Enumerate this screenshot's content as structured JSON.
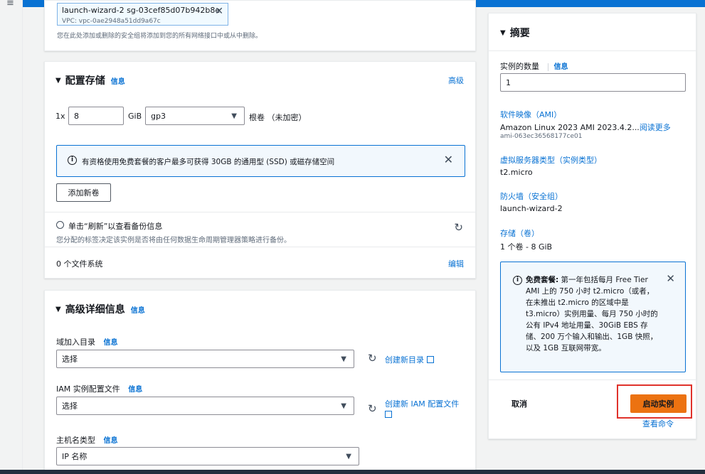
{
  "menu_icon": "menu-icon",
  "network": {
    "sg_chip_name": "launch-wizard-2   sg-03cef85d07b942b8e",
    "sg_chip_vpc": "VPC: vpc-0ae2948a51dd9a67c",
    "help_text": "您在此处添加或删除的安全组将添加到您的所有网络接口中或从中删除。"
  },
  "storage": {
    "title": "配置存储",
    "info": "信息",
    "advanced": "高级",
    "prefix": "1x",
    "size_value": "8",
    "size_unit": "GiB",
    "volume_type": "gp3",
    "root_label": "根卷  （未加密）",
    "alert_text": "有资格使用免费套餐的客户最多可获得 30GB 的通用型 (SSD) 或磁存储空间",
    "add_volume": "添加新卷",
    "backup_text": "单击“刷新”以查看备份信息",
    "backup_subtext": "您分配的标签决定该实例是否将由任何数据生命周期管理器策略进行备份。",
    "filesystems": "0 个文件系统",
    "edit": "编辑"
  },
  "advanced": {
    "title": "高级详细信息",
    "info": "信息",
    "domain_label": "域加入目录",
    "domain_info": "信息",
    "domain_value": "选择",
    "create_directory": "创建新目录",
    "iam_label": "IAM 实例配置文件",
    "iam_info": "信息",
    "iam_value": "选择",
    "create_iam": "创建新 IAM 配置文件",
    "hostname_label": "主机名类型",
    "hostname_info": "信息",
    "hostname_value": "IP 名称"
  },
  "summary": {
    "title": "摘要",
    "count_label": "实例的数量",
    "count_info": "信息",
    "count_value": "1",
    "ami_label": "软件映像（AMI）",
    "ami_value": "Amazon Linux 2023 AMI 2023.4.2...",
    "ami_more": "阅读更多",
    "ami_id": "ami-063ec36568177ce01",
    "type_label": "虚拟服务器类型（实例类型）",
    "type_value": "t2.micro",
    "firewall_label": "防火墙（安全组）",
    "firewall_value": "launch-wizard-2",
    "storage_label": "存储（卷）",
    "storage_value": "1 个卷 - 8 GiB",
    "free_tier_bold": "免费套餐:",
    "free_tier_text": " 第一年包括每月 Free Tier AMI 上的 750 小时 t2.micro（或者，在未推出 t2.micro 的区域中是 t3.micro）实例用量、每月 750 小时的公有 IPv4 地址用量、30GiB EBS 存储、200 万个输入和输出、1GB 快照，以及 1GB 互联网带宽。",
    "cancel": "取消",
    "launch": "启动实例",
    "view_commands": "查看命令"
  },
  "colors": {
    "accent": "#0972d3",
    "launch_button": "#ec7211",
    "highlight_border": "#e0322b"
  }
}
